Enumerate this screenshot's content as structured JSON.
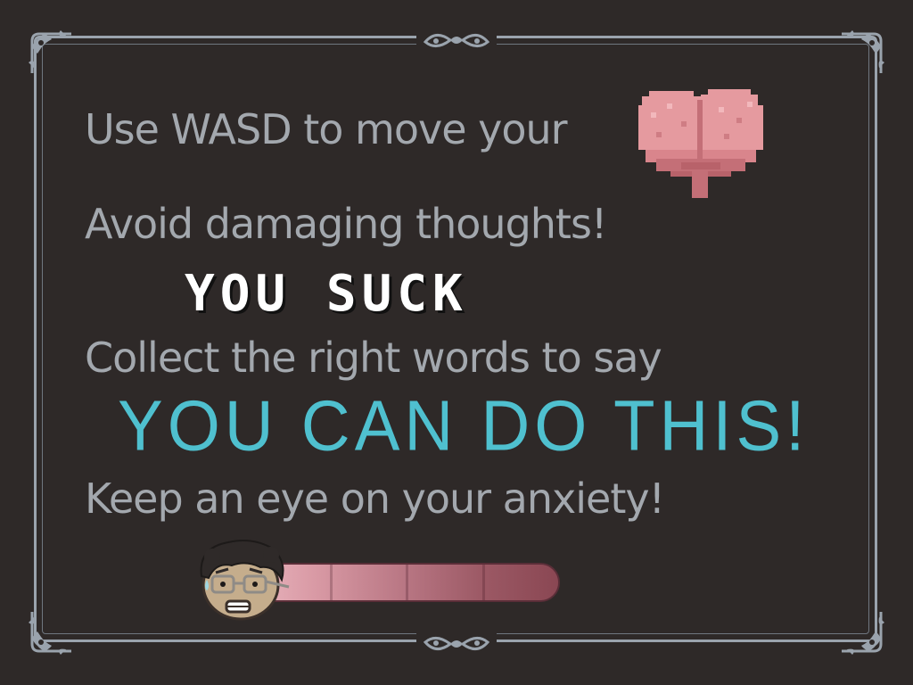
{
  "instructions": {
    "line1": "Use WASD to move your",
    "line2": "Avoid damaging thoughts!",
    "line3": "Collect the right words to say",
    "line4": "Keep an eye on your anxiety!"
  },
  "examples": {
    "bad_thought": "YOU SUCK",
    "good_words": "YOU CAN DO THIS!"
  },
  "icons": {
    "player": "brain-icon",
    "anxiety": "anxious-face-icon"
  },
  "colors": {
    "background": "#2e2928",
    "frame": "#9aa3ad",
    "text": "#a3a8ae",
    "bad_thought": "#ffffff",
    "good_words": "#4fc0cf",
    "brain": "#e59a9f",
    "anxiety_bar": "#8a4753"
  },
  "anxiety": {
    "level": 1.0
  }
}
